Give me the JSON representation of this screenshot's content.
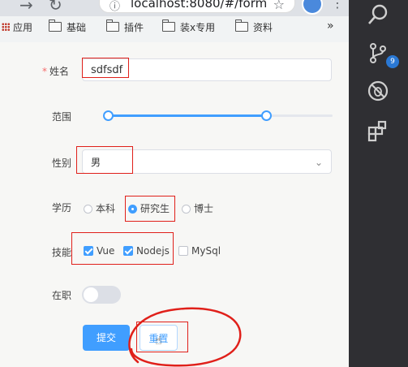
{
  "browser": {
    "url": "localhost:8080/#/form",
    "bookmarks": [
      "应用",
      "基础",
      "插件",
      "装x专用",
      "资料"
    ],
    "more": "»"
  },
  "form": {
    "name_label": "姓名",
    "required_mark": "*",
    "name_value": "sdfsdf",
    "range_label": "范围",
    "range_value": [
      0,
      70
    ],
    "gender_label": "性别",
    "gender_value": "男",
    "edu_label": "学历",
    "edu_options": [
      "本科",
      "研究生",
      "博士"
    ],
    "edu_selected": "研究生",
    "skills_label": "技能",
    "skills_options": [
      "Vue",
      "Nodejs",
      "MySql"
    ],
    "skills_checked": [
      "Vue",
      "Nodejs"
    ],
    "employed_label": "在职",
    "employed_value": false,
    "submit_label": "提交",
    "reset_label": "重置"
  },
  "activity_bar": {
    "source_control_badge": "9",
    "icons": [
      "search-icon",
      "source-control-icon",
      "debug-icon",
      "extensions-icon"
    ]
  },
  "colors": {
    "primary": "#409eff",
    "annotation": "#e0201a",
    "activity_bg": "#2f2f33"
  }
}
